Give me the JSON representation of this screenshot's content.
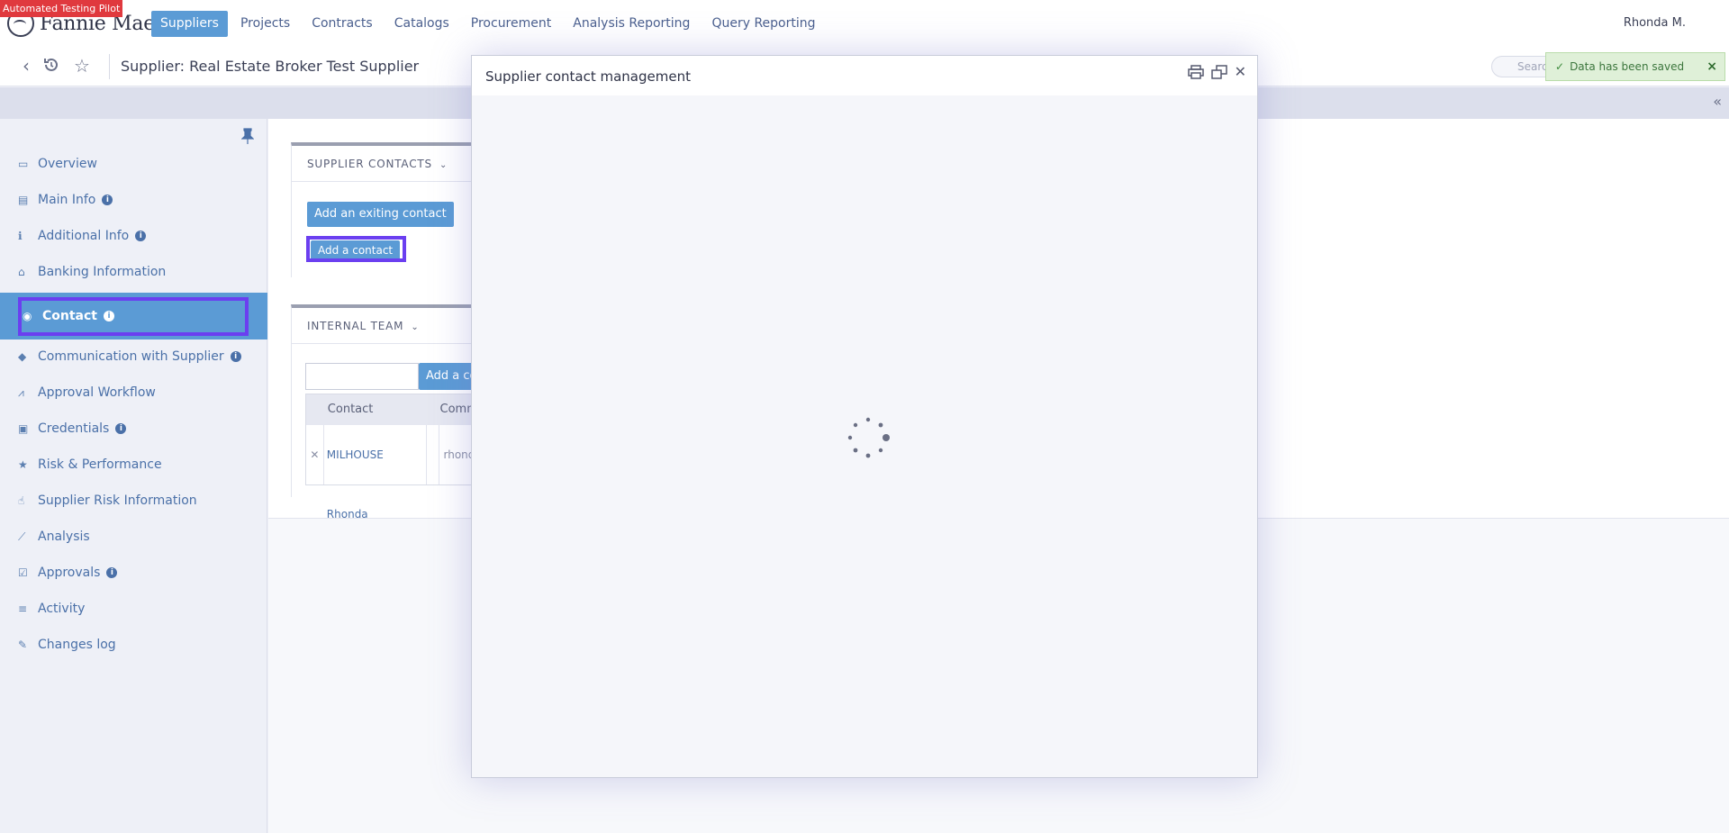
{
  "badge": "Automated Testing Pilot",
  "brand": {
    "name": "Fannie Mae",
    "tm": "™"
  },
  "nav": [
    {
      "label": "Suppliers",
      "active": true
    },
    {
      "label": "Projects"
    },
    {
      "label": "Contracts"
    },
    {
      "label": "Catalogs"
    },
    {
      "label": "Procurement"
    },
    {
      "label": "Analysis Reporting"
    },
    {
      "label": "Query Reporting"
    }
  ],
  "user": "Rhonda M.",
  "page_title": "Supplier: Real Estate Broker Test Supplier",
  "search_placeholder": "Search",
  "toast": {
    "message": "Data has been saved",
    "close": "×"
  },
  "sidebar": [
    {
      "label": "Overview",
      "icon": "monitor-icon",
      "glyph": "▭"
    },
    {
      "label": "Main Info",
      "icon": "id-card-icon",
      "glyph": "▤",
      "info": true
    },
    {
      "label": "Additional Info",
      "icon": "info-icon",
      "glyph": "ℹ",
      "info": true
    },
    {
      "label": "Banking Information",
      "icon": "bank-icon",
      "glyph": "⌂"
    },
    {
      "label": "Contact",
      "icon": "users-icon",
      "glyph": "◉",
      "info": true,
      "active": true
    },
    {
      "label": "Communication with Supplier",
      "icon": "comments-icon",
      "glyph": "◆",
      "info": true
    },
    {
      "label": "Approval Workflow",
      "icon": "road-icon",
      "glyph": "⩘"
    },
    {
      "label": "Credentials",
      "icon": "book-icon",
      "glyph": "▣",
      "info": true
    },
    {
      "label": "Risk & Performance",
      "icon": "star-icon",
      "glyph": "★"
    },
    {
      "label": "Supplier Risk Information",
      "icon": "thumbs-up-icon",
      "glyph": "☝"
    },
    {
      "label": "Analysis",
      "icon": "line-chart-icon",
      "glyph": "⟋"
    },
    {
      "label": "Approvals",
      "icon": "check-square-icon",
      "glyph": "☑",
      "info": true
    },
    {
      "label": "Activity",
      "icon": "list-icon",
      "glyph": "≡"
    },
    {
      "label": "Changes log",
      "icon": "edit-icon",
      "glyph": "✎"
    }
  ],
  "supplier_contacts": {
    "heading": "SUPPLIER CONTACTS",
    "add_existing": "Add an exiting contact",
    "add_contact": "Add a contact"
  },
  "internal_team": {
    "heading": "INTERNAL TEAM",
    "add_button": "Add a co",
    "columns": [
      "Contact",
      "Comm"
    ],
    "rows": [
      {
        "contact": "MILHOUSE Rhonda",
        "comm": "rhond"
      }
    ]
  },
  "modal": {
    "title": "Supplier contact management"
  }
}
